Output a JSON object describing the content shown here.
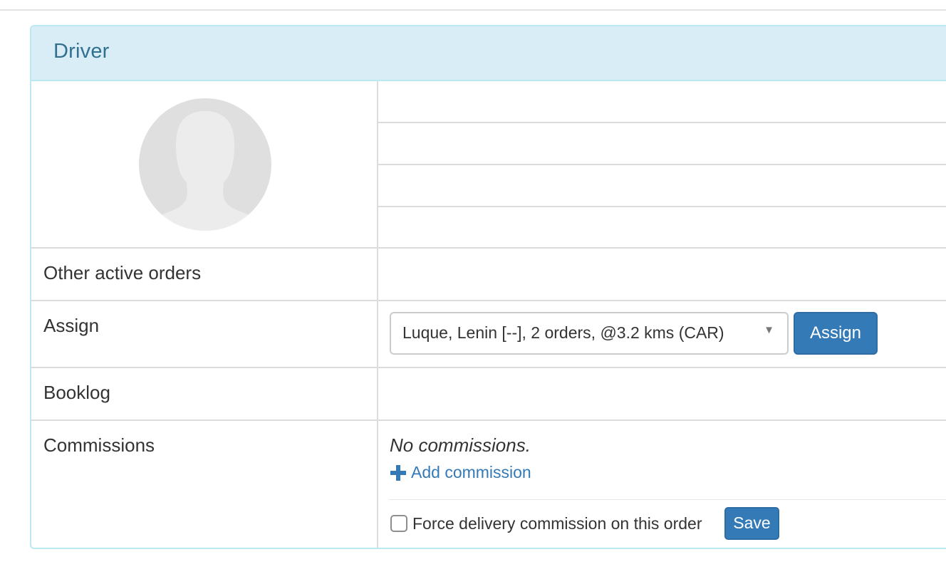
{
  "panel": {
    "title": "Driver"
  },
  "rows": {
    "other_active_orders": {
      "label": "Other active orders"
    },
    "assign": {
      "label": "Assign",
      "selected_driver": "Luque, Lenin [--], 2 orders, @3.2 kms (CAR)",
      "button_label": "Assign"
    },
    "booklog": {
      "label": "Booklog"
    },
    "commissions": {
      "label": "Commissions",
      "empty_text": "No commissions.",
      "add_link": "Add commission",
      "force_label": "Force delivery commission on this order",
      "save_label": "Save"
    }
  },
  "colors": {
    "heading_bg": "#d9edf7",
    "heading_text": "#31708f",
    "primary": "#337ab7"
  },
  "icons": {
    "avatar": "default-avatar-silhouette",
    "dropdown": "caret-down-icon",
    "add": "plus-icon"
  }
}
